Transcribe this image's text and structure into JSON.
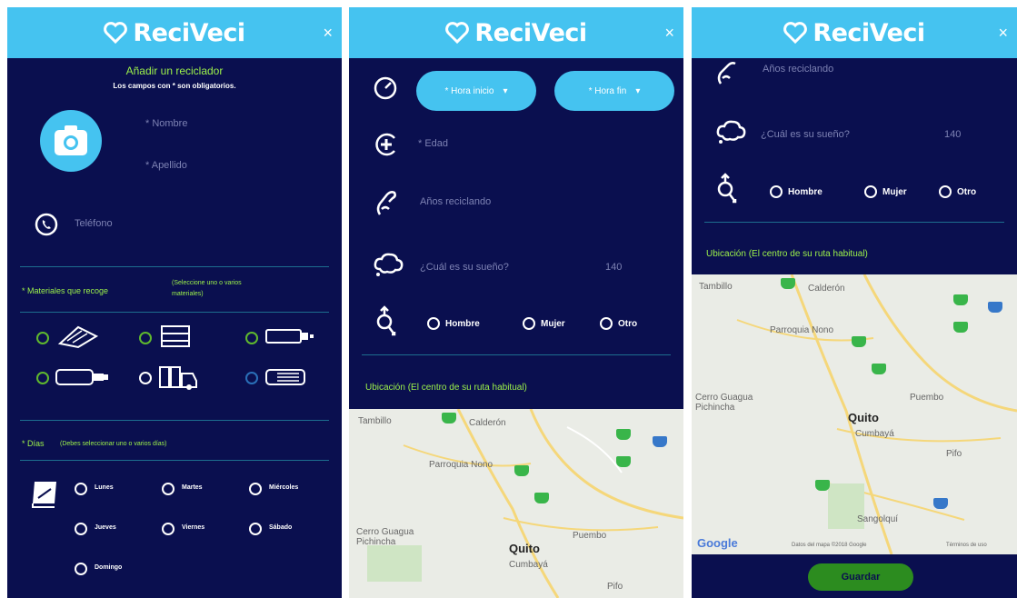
{
  "app": {
    "name": "ReciVeci",
    "close": "×"
  },
  "panel1": {
    "title": "Añadir un reciclador",
    "subtitle": "Los campos con * son obligatorios.",
    "nombre": "* Nombre",
    "apellido": "* Apellido",
    "telefono": "Teléfono",
    "materiales_label": "* Materiales que recoge",
    "materiales_hint_1": "(Seleccione uno o varios",
    "materiales_hint_2": "materiales)",
    "dias_label": "* Días",
    "dias_hint": "(Debes seleccionar uno o varios días)",
    "dias": [
      "Lunes",
      "Martes",
      "Miércoles",
      "Jueves",
      "Viernes",
      "Sábado",
      "Domingo"
    ]
  },
  "panel2": {
    "hora_inicio": "* Hora inicio",
    "hora_fin": "* Hora fin",
    "edad": "* Edad",
    "anios": "Años reciclando",
    "sueno": "¿Cuál es su sueño?",
    "sueno_count": "140",
    "generos": [
      "Hombre",
      "Mujer",
      "Otro"
    ],
    "ubicacion": "Ubicación (El centro de su ruta habitual)",
    "map_labels": [
      "Tambillo",
      "Calderón",
      "Parroquia Nono",
      "Cerro Guagua Pichincha",
      "Quito",
      "Cumbayá",
      "Puembo",
      "Pifo"
    ]
  },
  "panel3": {
    "anios": "Años reciclando",
    "sueno": "¿Cuál es su sueño?",
    "sueno_count": "140",
    "generos": [
      "Hombre",
      "Mujer",
      "Otro"
    ],
    "ubicacion": "Ubicación (El centro de su ruta habitual)",
    "map_labels": [
      "Tambillo",
      "Calderón",
      "Parroquia Nono",
      "Cerro Guagua Pichincha",
      "Quito",
      "Cumbayá",
      "Puembo",
      "Pifo",
      "Sangolquí"
    ],
    "google": "Google",
    "map_credit": "Datos del mapa ©2018 Google",
    "map_terms": "Términos de uso",
    "save": "Guardar"
  }
}
